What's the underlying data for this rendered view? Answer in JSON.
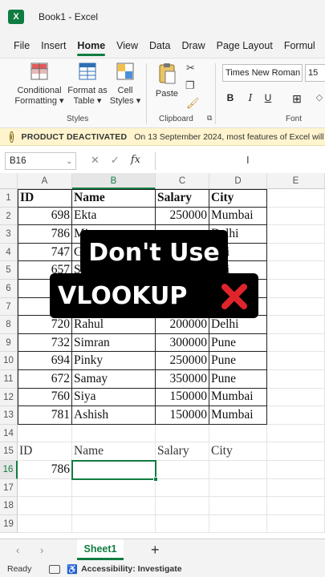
{
  "window": {
    "title": "Book1  -  Excel"
  },
  "menu": {
    "tabs": [
      "File",
      "Insert",
      "Home",
      "View",
      "Data",
      "Draw",
      "Page Layout",
      "Formul"
    ],
    "active": "Home"
  },
  "ribbon": {
    "conditional_formatting": "Conditional\nFormatting ▾",
    "format_as_table": "Format as\nTable ▾",
    "cell_styles": "Cell\nStyles ▾",
    "styles_group": "Styles",
    "paste": "Paste",
    "clipboard_group": "Clipboard",
    "font_name": "Times New Roman",
    "font_size": "15",
    "font_group": "Font",
    "bold": "B",
    "italic": "I",
    "underline": "U"
  },
  "infobar": {
    "title": "PRODUCT DEACTIVATED",
    "message": "On 13 September 2024, most features of Excel will b"
  },
  "formula_bar": {
    "name_box": "B16",
    "fx": "fx",
    "value": ""
  },
  "grid": {
    "columns": [
      "A",
      "B",
      "C",
      "D",
      "E"
    ],
    "rows": [
      "1",
      "2",
      "3",
      "4",
      "5",
      "6",
      "7",
      "8",
      "9",
      "10",
      "11",
      "12",
      "13",
      "14",
      "15",
      "16",
      "17",
      "18",
      "19"
    ],
    "table_header": [
      "ID",
      "Name",
      "Salary",
      "City"
    ],
    "table_rows": [
      [
        "698",
        "Ekta",
        "250000",
        "Mumbai"
      ],
      [
        "786",
        "Mi",
        "",
        "Delhi"
      ],
      [
        "747",
        "G",
        "",
        "elhi"
      ],
      [
        "657",
        "S",
        "",
        "elhi"
      ],
      [
        "",
        "",
        "",
        ""
      ],
      [
        "",
        "",
        "",
        ""
      ],
      [
        "720",
        "Rahul",
        "200000",
        "Delhi"
      ],
      [
        "732",
        "Simran",
        "300000",
        "Pune"
      ],
      [
        "694",
        "Pinky",
        "250000",
        "Pune"
      ],
      [
        "672",
        "Samay",
        "350000",
        "Pune"
      ],
      [
        "760",
        "Siya",
        "150000",
        "Mumbai"
      ],
      [
        "781",
        "Ashish",
        "150000",
        "Mumbai"
      ]
    ],
    "lookup_header": [
      "ID",
      "Name",
      "Salary",
      "City"
    ],
    "lookup_id": "786"
  },
  "overlay": {
    "line1": "Don't Use",
    "line2": "VLOOKUP",
    "icon": "red-cross-icon"
  },
  "sheets": {
    "tabs": [
      "Sheet1"
    ],
    "add": "+"
  },
  "status": {
    "ready": "Ready",
    "accessibility": "Accessibility: Investigate"
  }
}
